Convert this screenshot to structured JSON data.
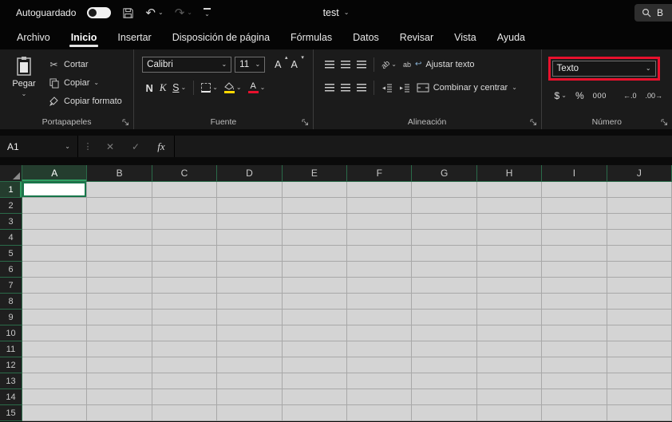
{
  "titlebar": {
    "autosave_label": "Autoguardado",
    "document_title": "test",
    "search_text": "B"
  },
  "tabs": [
    "Archivo",
    "Inicio",
    "Insertar",
    "Disposición de página",
    "Fórmulas",
    "Datos",
    "Revisar",
    "Vista",
    "Ayuda"
  ],
  "ribbon": {
    "clipboard": {
      "paste": "Pegar",
      "cut": "Cortar",
      "copy": "Copiar",
      "format_painter": "Copiar formato",
      "group": "Portapapeles"
    },
    "font": {
      "name": "Calibri",
      "size": "11",
      "bold": "N",
      "italic": "K",
      "underline": "S",
      "grow": "A",
      "shrink": "A",
      "group": "Fuente"
    },
    "alignment": {
      "wrap": "Ajustar texto",
      "merge": "Combinar y centrar",
      "group": "Alineación"
    },
    "number": {
      "format": "Texto",
      "currency": "$",
      "percent": "%",
      "thousands": "000",
      "inc_decimal": "←.0",
      "dec_decimal": ".00→",
      "group": "Número",
      "highlight": "#e8112d"
    }
  },
  "formula_bar": {
    "name_box": "A1",
    "fx": "fx"
  },
  "grid": {
    "columns": [
      "A",
      "B",
      "C",
      "D",
      "E",
      "F",
      "G",
      "H",
      "I",
      "J"
    ],
    "rows": [
      "1",
      "2",
      "3",
      "4",
      "5",
      "6",
      "7",
      "8",
      "9",
      "10",
      "11",
      "12",
      "13",
      "14",
      "15"
    ],
    "selected_cell": "A1"
  },
  "icons": {
    "chevron_down": "⌄",
    "caret_up": "▴",
    "caret_down": "▾",
    "undo": "↶",
    "redo": "↷",
    "scissors": "✂",
    "cancel": "✕",
    "check": "✓",
    "dots": "⋮",
    "ab": "ab",
    "wrap_arrow": "↩"
  }
}
